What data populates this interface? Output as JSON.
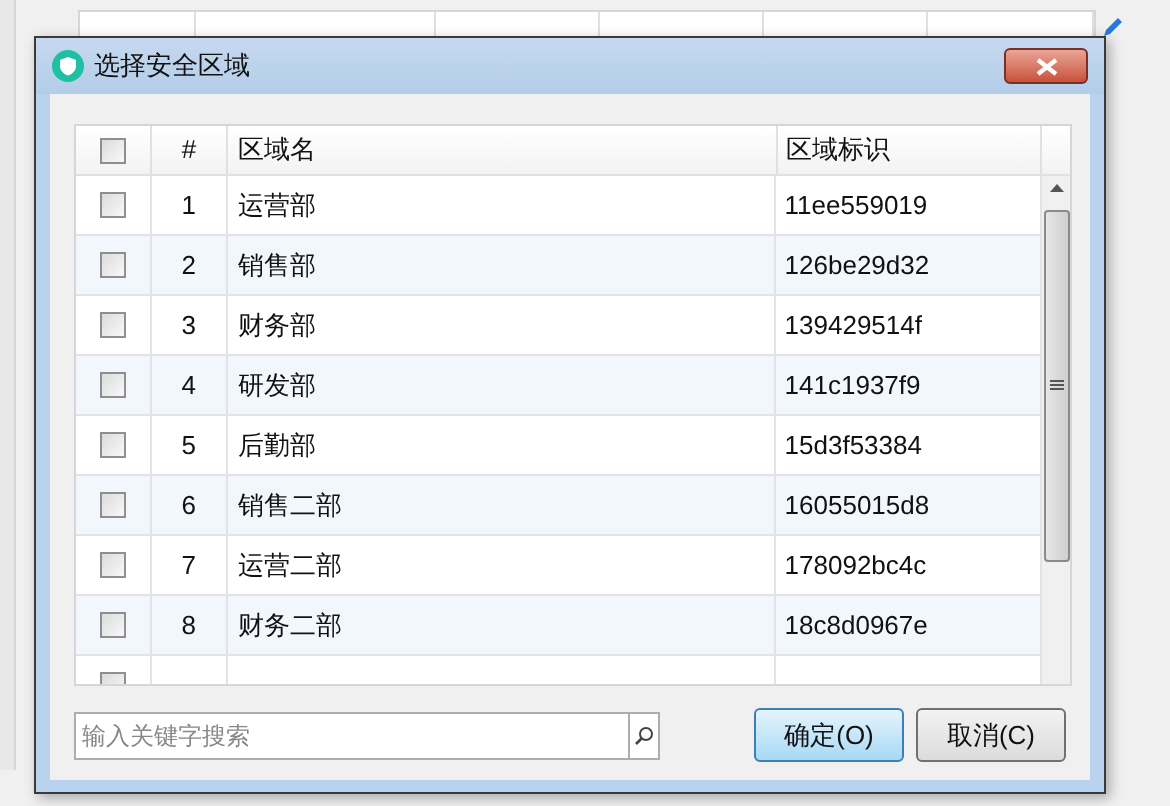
{
  "dialog": {
    "title": "选择安全区域",
    "table": {
      "select_all": {
        "checked": false
      },
      "columns": [
        "#",
        "区域名",
        "区域标识"
      ],
      "rows": [
        {
          "checked": false,
          "number": "1",
          "name": "运营部",
          "id": "11ee559019"
        },
        {
          "checked": false,
          "number": "2",
          "name": "销售部",
          "id": "126be29d32"
        },
        {
          "checked": false,
          "number": "3",
          "name": "财务部",
          "id": "139429514f"
        },
        {
          "checked": false,
          "number": "4",
          "name": "研发部",
          "id": "141c1937f9"
        },
        {
          "checked": false,
          "number": "5",
          "name": "后勤部",
          "id": "15d3f53384"
        },
        {
          "checked": false,
          "number": "6",
          "name": "销售二部",
          "id": "16055015d8"
        },
        {
          "checked": false,
          "number": "7",
          "name": "运营二部",
          "id": "178092bc4c"
        },
        {
          "checked": false,
          "number": "8",
          "name": "财务二部",
          "id": "18c8d0967e"
        },
        {
          "checked": false
        }
      ]
    },
    "search": {
      "placeholder": "输入关键字搜索"
    },
    "buttons": [
      {
        "label": "确定(O)",
        "focused": true
      },
      {
        "label": "取消(C)",
        "focused": false
      }
    ]
  }
}
